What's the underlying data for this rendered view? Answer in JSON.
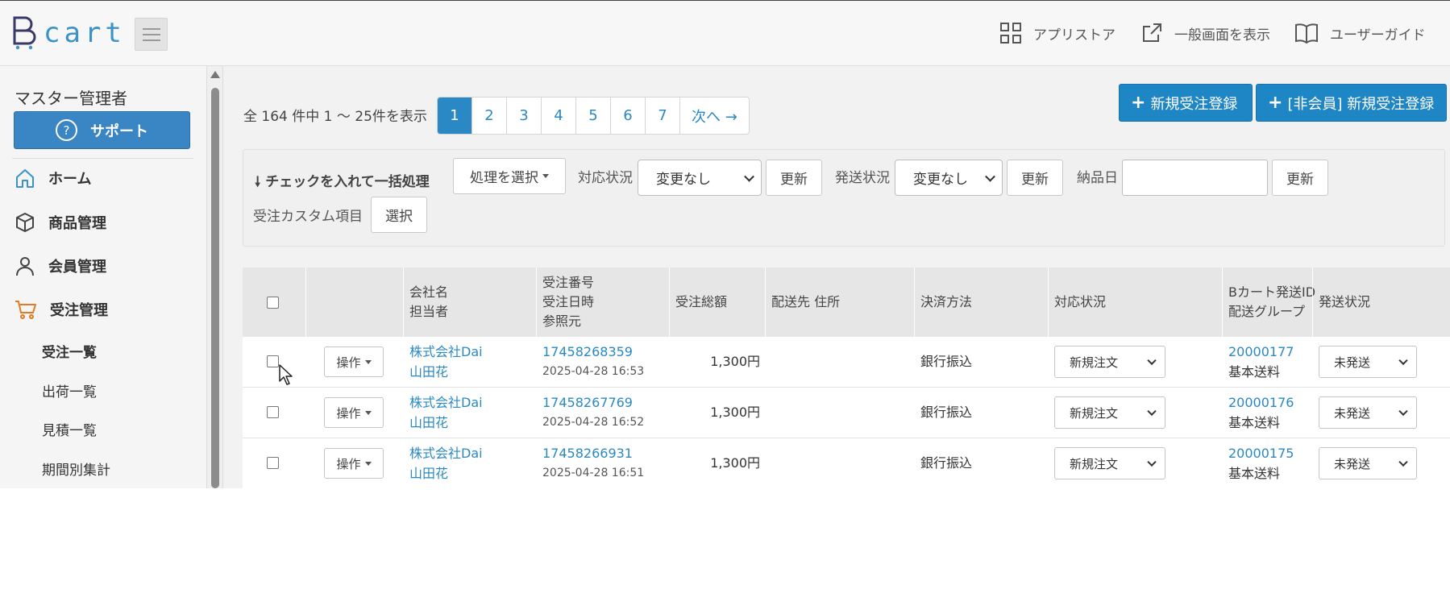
{
  "header": {
    "logo_text": "cart",
    "app_store": "アプリストア",
    "view_public": "一般画面を表示",
    "user_guide": "ユーザーガイド"
  },
  "sidebar": {
    "admin_name": "マスター管理者",
    "support_label": "サポート",
    "items": [
      {
        "label": "ホーム",
        "icon": "home-icon"
      },
      {
        "label": "商品管理",
        "icon": "cube-icon"
      },
      {
        "label": "会員管理",
        "icon": "user-icon"
      },
      {
        "label": "受注管理",
        "icon": "cart-icon"
      }
    ],
    "sub_items": [
      "受注一覧",
      "出荷一覧",
      "見積一覧",
      "期間別集計"
    ]
  },
  "main": {
    "count_text": "全 164 件中 1 〜 25件を表示",
    "pages": [
      "1",
      "2",
      "3",
      "4",
      "5",
      "6",
      "7",
      "次へ →"
    ],
    "current_page": "1",
    "new_order_button": "新規受注登録",
    "new_guest_order_button": "[非会員] 新規受注登録"
  },
  "bulk": {
    "title": "チェックを入れて一括処理",
    "process_select": "処理を選択",
    "status_label": "対応状況",
    "status_value": "変更なし",
    "update_label": "更新",
    "shipping_label": "発送状況",
    "shipping_value": "変更なし",
    "delivery_date_label": "納品日",
    "delivery_date_value": "",
    "custom_label": "受注カスタム項目",
    "select_label": "選択"
  },
  "table": {
    "headers": {
      "company": "会社名",
      "person": "担当者",
      "order_no": "受注番号",
      "order_date": "受注日時",
      "referrer": "参照元",
      "total": "受注総額",
      "address": "配送先 住所",
      "payment": "決済方法",
      "status": "対応状況",
      "ship_id": "Bカート発送ID",
      "ship_group": "配送グループ",
      "ship_status": "発送状況"
    },
    "op_label": "操作",
    "rows": [
      {
        "company": "株式会社Dai",
        "person": "山田花",
        "order_no": "17458268359",
        "date": "2025-04-28 16:53",
        "total": "1,300円",
        "payment": "銀行振込",
        "status": "新規注文",
        "ship_id": "20000177",
        "ship_group": "基本送料",
        "ship_status": "未発送"
      },
      {
        "company": "株式会社Dai",
        "person": "山田花",
        "order_no": "17458267769",
        "date": "2025-04-28 16:52",
        "total": "1,300円",
        "payment": "銀行振込",
        "status": "新規注文",
        "ship_id": "20000176",
        "ship_group": "基本送料",
        "ship_status": "未発送"
      },
      {
        "company": "株式会社Dai",
        "person": "山田花",
        "order_no": "17458266931",
        "date": "2025-04-28 16:51",
        "total": "1,300円",
        "payment": "銀行振込",
        "status": "新規注文",
        "ship_id": "20000175",
        "ship_group": "基本送料",
        "ship_status": "未発送"
      }
    ]
  },
  "colors": {
    "accent": "#2a88c4",
    "support": "#3a86c4",
    "cart_icon": "#e07b22"
  }
}
